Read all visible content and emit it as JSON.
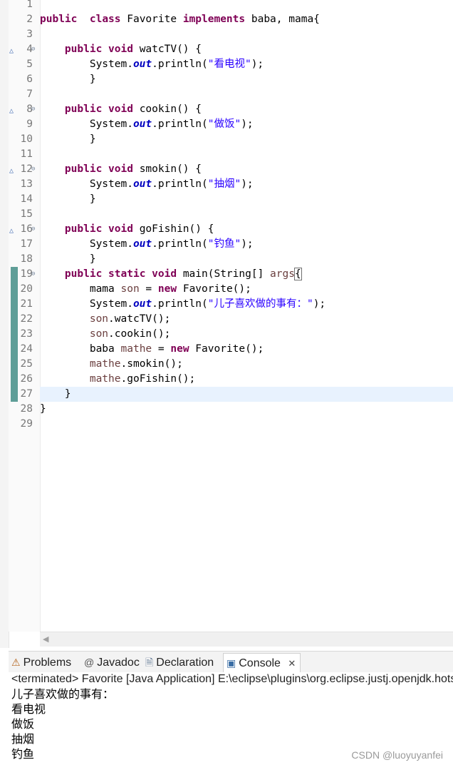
{
  "editor": {
    "lines": [
      {
        "n": "1",
        "t": []
      },
      {
        "n": "2",
        "t": [
          [
            "kw",
            "public"
          ],
          [
            "",
            "  "
          ],
          [
            "kw",
            "class"
          ],
          [
            "",
            " Favorite "
          ],
          [
            "kw",
            "implements"
          ],
          [
            "",
            " baba, mama{"
          ]
        ]
      },
      {
        "n": "3",
        "t": []
      },
      {
        "n": "4",
        "fold": true,
        "over": true,
        "t": [
          [
            "",
            "    "
          ],
          [
            "kw",
            "public"
          ],
          [
            "",
            " "
          ],
          [
            "kw",
            "void"
          ],
          [
            "",
            " watcTV() {"
          ]
        ]
      },
      {
        "n": "5",
        "t": [
          [
            "",
            "        System."
          ],
          [
            "fld",
            "out"
          ],
          [
            "",
            ".println("
          ],
          [
            "str",
            "\"看电视\""
          ],
          [
            "",
            ");"
          ]
        ]
      },
      {
        "n": "6",
        "t": [
          [
            "",
            "        }"
          ]
        ]
      },
      {
        "n": "7",
        "t": []
      },
      {
        "n": "8",
        "fold": true,
        "over": true,
        "t": [
          [
            "",
            "    "
          ],
          [
            "kw",
            "public"
          ],
          [
            "",
            " "
          ],
          [
            "kw",
            "void"
          ],
          [
            "",
            " cookin() {"
          ]
        ]
      },
      {
        "n": "9",
        "t": [
          [
            "",
            "        System."
          ],
          [
            "fld",
            "out"
          ],
          [
            "",
            ".println("
          ],
          [
            "str",
            "\"做饭\""
          ],
          [
            "",
            ");"
          ]
        ]
      },
      {
        "n": "10",
        "t": [
          [
            "",
            "        }"
          ]
        ]
      },
      {
        "n": "11",
        "t": []
      },
      {
        "n": "12",
        "fold": true,
        "over": true,
        "t": [
          [
            "",
            "    "
          ],
          [
            "kw",
            "public"
          ],
          [
            "",
            " "
          ],
          [
            "kw",
            "void"
          ],
          [
            "",
            " smokin() {"
          ]
        ]
      },
      {
        "n": "13",
        "t": [
          [
            "",
            "        System."
          ],
          [
            "fld",
            "out"
          ],
          [
            "",
            ".println("
          ],
          [
            "str",
            "\"抽烟\""
          ],
          [
            "",
            ");"
          ]
        ]
      },
      {
        "n": "14",
        "t": [
          [
            "",
            "        }"
          ]
        ]
      },
      {
        "n": "15",
        "t": []
      },
      {
        "n": "16",
        "fold": true,
        "over": true,
        "t": [
          [
            "",
            "    "
          ],
          [
            "kw",
            "public"
          ],
          [
            "",
            " "
          ],
          [
            "kw",
            "void"
          ],
          [
            "",
            " goFishin() {"
          ]
        ]
      },
      {
        "n": "17",
        "t": [
          [
            "",
            "        System."
          ],
          [
            "fld",
            "out"
          ],
          [
            "",
            ".println("
          ],
          [
            "str",
            "\"钓鱼\""
          ],
          [
            "",
            ");"
          ]
        ]
      },
      {
        "n": "18",
        "t": [
          [
            "",
            "        }"
          ]
        ]
      },
      {
        "n": "19",
        "fold": true,
        "chg": true,
        "t": [
          [
            "",
            "    "
          ],
          [
            "kw",
            "public"
          ],
          [
            "",
            " "
          ],
          [
            "kw",
            "static"
          ],
          [
            "",
            " "
          ],
          [
            "kw",
            "void"
          ],
          [
            "",
            " main(String[] "
          ],
          [
            "param",
            "args"
          ],
          [
            ") "
          ],
          [
            "brk",
            "{"
          ]
        ]
      },
      {
        "n": "20",
        "chg": true,
        "t": [
          [
            "",
            "        mama "
          ],
          [
            "var",
            "son"
          ],
          [
            "",
            " = "
          ],
          [
            "kw",
            "new"
          ],
          [
            "",
            " Favorite();"
          ]
        ]
      },
      {
        "n": "21",
        "chg": true,
        "t": [
          [
            "",
            "        System."
          ],
          [
            "fld",
            "out"
          ],
          [
            "",
            ".println("
          ],
          [
            "str",
            "\"儿子喜欢做的事有：\""
          ],
          [
            "",
            ");"
          ]
        ]
      },
      {
        "n": "22",
        "chg": true,
        "t": [
          [
            "",
            "        "
          ],
          [
            "var",
            "son"
          ],
          [
            "",
            ".watcTV();"
          ]
        ]
      },
      {
        "n": "23",
        "chg": true,
        "t": [
          [
            "",
            "        "
          ],
          [
            "var",
            "son"
          ],
          [
            "",
            ".cookin();"
          ]
        ]
      },
      {
        "n": "24",
        "chg": true,
        "t": [
          [
            "",
            "        baba "
          ],
          [
            "var",
            "mathe"
          ],
          [
            "",
            " = "
          ],
          [
            "kw",
            "new"
          ],
          [
            "",
            " Favorite();"
          ]
        ]
      },
      {
        "n": "25",
        "chg": true,
        "t": [
          [
            "",
            "        "
          ],
          [
            "var",
            "mathe"
          ],
          [
            "",
            ".smokin();"
          ]
        ]
      },
      {
        "n": "26",
        "chg": true,
        "t": [
          [
            "",
            "        "
          ],
          [
            "var",
            "mathe"
          ],
          [
            "",
            ".goFishin();"
          ]
        ]
      },
      {
        "n": "27",
        "chg": true,
        "current": true,
        "t": [
          [
            "",
            "    }"
          ]
        ]
      },
      {
        "n": "28",
        "t": [
          [
            "",
            "}"
          ]
        ]
      },
      {
        "n": "29",
        "t": []
      }
    ]
  },
  "tabs": [
    {
      "id": "problems",
      "label": "Problems",
      "icon": "problems-icon",
      "glyph": "⚠",
      "color": "#b5651d",
      "active": false
    },
    {
      "id": "javadoc",
      "label": "Javadoc",
      "icon": "javadoc-icon",
      "glyph": "@",
      "color": "#555555",
      "active": false
    },
    {
      "id": "declaration",
      "label": "Declaration",
      "icon": "declaration-icon",
      "glyph": "🗎",
      "color": "#6a7f9a",
      "active": false
    },
    {
      "id": "console",
      "label": "Console",
      "icon": "console-icon",
      "glyph": "▣",
      "color": "#3a6ea5",
      "active": true
    }
  ],
  "console": {
    "close_glyph": "✕",
    "status": "<terminated> Favorite [Java Application] E:\\eclipse\\plugins\\org.eclipse.justj.openjdk.hotspot.jre.full",
    "output": [
      "儿子喜欢做的事有：",
      "看电视",
      "做饭",
      "抽烟",
      "钓鱼"
    ]
  },
  "watermark": "CSDN @luoyuyanfei"
}
